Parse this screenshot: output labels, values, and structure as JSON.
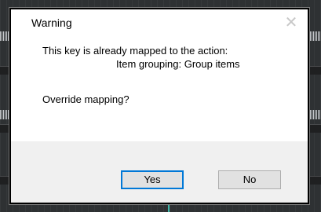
{
  "dialog": {
    "title": "Warning",
    "close_glyph": "✕",
    "message_line1": "This key is already mapped to the action:",
    "message_line2": "Item grouping: Group items",
    "question": "Override mapping?",
    "buttons": {
      "yes": "Yes",
      "no": "No"
    }
  },
  "colors": {
    "default_button_border": "#0078d7",
    "footer_bg": "#f0f0f0",
    "playhead": "#3fb6a8"
  }
}
